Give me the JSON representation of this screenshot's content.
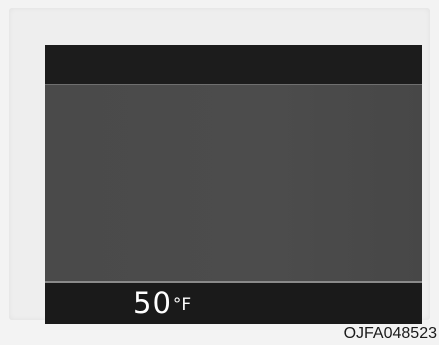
{
  "display": {
    "temperature_value": "50",
    "temperature_unit": "°F"
  },
  "figure": {
    "reference_code": "OJFA048523"
  },
  "colors": {
    "screen_background": "#1b1b1b",
    "main_area": "#4a4a4a",
    "text": "#ffffff"
  }
}
